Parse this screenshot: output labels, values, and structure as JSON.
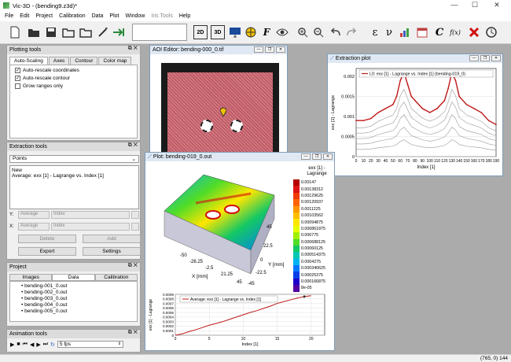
{
  "window": {
    "title": "Vic-3D - (bending9.z3d)*",
    "minimize": "—",
    "maximize": "☐",
    "close": "✕"
  },
  "menu": [
    "File",
    "Edit",
    "Project",
    "Calibration",
    "Data",
    "Plot",
    "Window",
    "Iris Tools",
    "Help"
  ],
  "toolbar": {
    "label_2d": "2D",
    "label_3d": "3D",
    "epsilon": "ε",
    "nu": "ν",
    "c": "C",
    "fx": "f(x)",
    "script_f": "F"
  },
  "plotting_tools": {
    "title": "Plotting tools",
    "tabs": [
      "Auto-Scaling",
      "Axes",
      "Contour",
      "Color map"
    ],
    "checkboxes": [
      {
        "label": "Auto-rescale coordinates",
        "checked": true
      },
      {
        "label": "Auto-rescale contour",
        "checked": true
      },
      {
        "label": "Grow ranges only",
        "checked": false
      }
    ]
  },
  "extraction_tools": {
    "title": "Extraction tools",
    "mode": "Points",
    "list": [
      "New",
      "Average: exx [1] - Lagrange vs. Index [1]"
    ],
    "y_label": "Y:",
    "x_label": "X:",
    "y_select1": "Average",
    "y_select2": "Index",
    "x_select1": "Average",
    "x_select2": "Index",
    "delete": "Delete",
    "add": "Add",
    "export": "Export",
    "settings": "Settings"
  },
  "project": {
    "title": "Project",
    "tabs": [
      "Images",
      "Data",
      "Calibration"
    ],
    "files": [
      "bending-001_0.out",
      "bending-002_0.out",
      "bending-003_0.out",
      "bending-004_0.out",
      "bending-005_0.out"
    ]
  },
  "animation": {
    "title": "Animation tools",
    "fps": "5 fps"
  },
  "aoi_editor": {
    "title": "AOI Editor: bending-000_0.tif"
  },
  "extraction_plot": {
    "title": "Extraction plot",
    "legend": "L0: exx [1] - Lagrange vs. Index [1] (bending-019_0)",
    "ylabel": "exx [1] - Lagrange",
    "xlabel": "Index [1]",
    "yticks": [
      "0.002",
      "0.0015",
      "0.001",
      "0.0005",
      "0"
    ],
    "xticks": [
      "0",
      "10",
      "20",
      "30",
      "40",
      "50",
      "60",
      "70",
      "80",
      "90",
      "100",
      "110",
      "120",
      "130",
      "140",
      "150",
      "160",
      "170",
      "180",
      "190"
    ]
  },
  "plot_window": {
    "title": "Plot: bending-019_0.out",
    "colorbar_title": "exx [1] - Lagrange",
    "colorbar_values": [
      "0.00147",
      "0.00138312",
      "0.00129625",
      "0.00120937",
      "0.0011225",
      "0.00103562",
      "0.00094875",
      "0.000861875",
      "0.000775",
      "0.000688125",
      "0.00060125",
      "0.000514375",
      "0.0004275",
      "0.000340625",
      "0.00025375",
      "0.000166875",
      "8e-05"
    ],
    "colorbar_colors": [
      "#b40000",
      "#dc1414",
      "#f03c00",
      "#ff6400",
      "#ff9600",
      "#ffbe00",
      "#ffe600",
      "#e6ff00",
      "#a0f000",
      "#50dc28",
      "#14c864",
      "#00c8b4",
      "#00b4f0",
      "#0078ff",
      "#0040e6",
      "#1e00c8",
      "#5000a0"
    ],
    "axis_x_label": "X [mm]",
    "axis_y_label": "Y [mm]",
    "x_ticks": [
      "-50",
      "-26.25",
      "-2.5",
      "21.25",
      "45"
    ],
    "y_ticks": [
      "45",
      "22.5",
      "0",
      "-22.5",
      "-45"
    ]
  },
  "line_plot": {
    "legend": "Average: exx [1] - Lagrange vs. Index [1]",
    "ylabel": "exx [1] - Lagrange",
    "xlabel": "Index [1]",
    "yticks": [
      "0.0009",
      "0.0008",
      "0.0007",
      "0.0006",
      "0.0005",
      "0.0004",
      "0.0003",
      "0.0002",
      "0.0001",
      "0"
    ],
    "xticks": [
      "0",
      "5",
      "10",
      "15",
      "20"
    ]
  },
  "status": {
    "coords": "(765, 0) 144"
  },
  "chart_data": [
    {
      "type": "line",
      "title": "",
      "xlabel": "Index [1]",
      "ylabel": "exx [1] - Lagrange",
      "xlim": [
        0,
        190
      ],
      "ylim": [
        0,
        0.0022
      ],
      "series": [
        {
          "name": "L0: exx [1] - Lagrange vs. Index [1] (bending-019_0)",
          "x": [
            0,
            10,
            20,
            30,
            40,
            50,
            55,
            60,
            65,
            70,
            75,
            80,
            90,
            100,
            110,
            120,
            125,
            130,
            135,
            140,
            150,
            160,
            170,
            180,
            190
          ],
          "y": [
            0.0009,
            0.0009,
            0.00095,
            0.0011,
            0.0012,
            0.0013,
            0.0015,
            0.0019,
            0.0021,
            0.0018,
            0.0015,
            0.0014,
            0.0012,
            0.0011,
            0.0012,
            0.0014,
            0.0017,
            0.0021,
            0.0019,
            0.0015,
            0.0013,
            0.0012,
            0.0011,
            0.0009,
            0.0008
          ]
        }
      ]
    },
    {
      "type": "line",
      "title": "",
      "xlabel": "Index [1]",
      "ylabel": "exx [1] - Lagrange",
      "xlim": [
        0,
        22
      ],
      "ylim": [
        0,
        0.0009
      ],
      "series": [
        {
          "name": "Average: exx [1] - Lagrange vs. Index [1]",
          "x": [
            0,
            1,
            2,
            3,
            4,
            5,
            6,
            7,
            8,
            9,
            10,
            11,
            12,
            13,
            14,
            15,
            16,
            17,
            18,
            19,
            20
          ],
          "y": [
            0,
            3e-05,
            8e-05,
            0.00012,
            0.00017,
            0.00022,
            0.00026,
            0.0003,
            0.00035,
            0.0004,
            0.00045,
            0.0005,
            0.00054,
            0.00059,
            0.00064,
            0.0007,
            0.00074,
            0.00078,
            0.00082,
            0.00085,
            0.00087
          ]
        }
      ]
    }
  ]
}
